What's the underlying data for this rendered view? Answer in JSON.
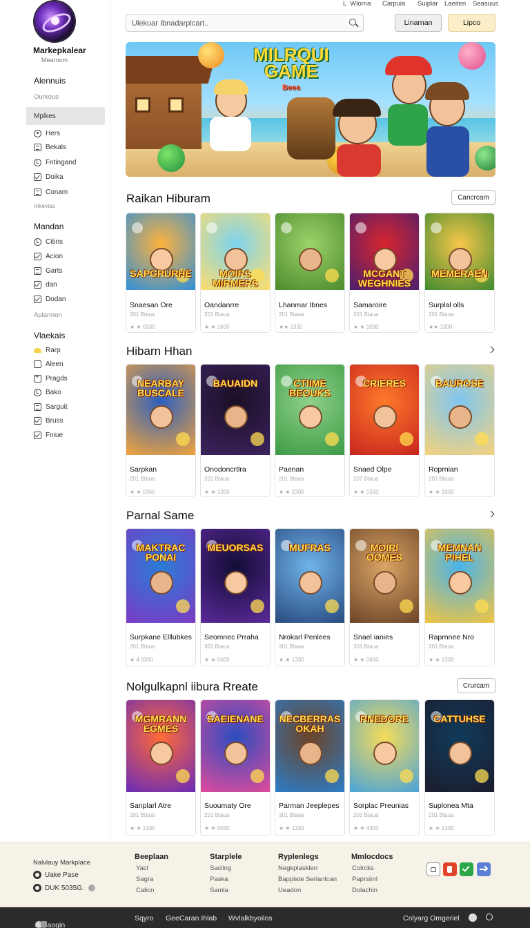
{
  "topnav": [
    "Wlorna",
    "Carpuia",
    "Suiplar",
    "Laeiten",
    "Seasuus"
  ],
  "search": {
    "placeholder": "Ulekuar Ibnadarplcart.."
  },
  "header_buttons": {
    "left": "Linarnan",
    "right": "Lipco"
  },
  "sidebar": {
    "brand": "Markepkalear",
    "brand_sub": "Mearnom",
    "sec1_title": "Alennuis",
    "sec1_muted": "Ourkous",
    "active": "Mplkes",
    "items1": [
      "Hers",
      "Bekals",
      "Fntingand",
      "Doika",
      "Conam"
    ],
    "muted2": "Inkeviss",
    "sec2_title": "Mandan",
    "items2": [
      "Citins",
      "Acion",
      "Garts",
      "dan",
      "Dodan"
    ],
    "muted3": "Aplarmon",
    "sec3_title": "Vlaekais",
    "items3": [
      "Rarp",
      "Aleen",
      "Pragds",
      "Bako",
      "Sarguit",
      "Bruss",
      "Fniue"
    ]
  },
  "hero": {
    "title_line1": "MILRQUI",
    "title_line2": "GAME",
    "title_sub": "Beea"
  },
  "sections": [
    {
      "title": "Raikan Hiburam",
      "action": "Cancrcam",
      "cards": [
        {
          "art": "SAPGRURHE",
          "name": "Snaesan Ore",
          "meta": "201 Btaua",
          "rating": "★ ★ 0330"
        },
        {
          "art": "MOIRS MIRMERS",
          "name": "Oandanrre",
          "meta": "201 Btaua",
          "rating": "★ ★ 1600"
        },
        {
          "art": "",
          "name": "Lhanmar Ibnes",
          "meta": "201 Btaua",
          "rating": "★★ 1330"
        },
        {
          "art": "MCGANT WEGHNIES",
          "name": "Samaroire",
          "meta": "201 Btaua",
          "rating": "★ ★ 1030"
        },
        {
          "art": "MEMERAEN",
          "name": "Surplal olls",
          "meta": "201 Btaua",
          "rating": "★★ 1300"
        }
      ]
    },
    {
      "title": "Hibarn Hhan",
      "action": "",
      "cards": [
        {
          "art": "NEARBAY BUSCALE",
          "name": "Sarpkan",
          "meta": "201 Btaua",
          "rating": "★ ★ 0350"
        },
        {
          "art": "BAUAIDN",
          "name": "Onodoncrtlra",
          "meta": "201 Btaua",
          "rating": "★ ★ 1300"
        },
        {
          "art": "CTIIME BEOUKS",
          "name": "Paenan",
          "meta": "201 Btaua",
          "rating": "★ ★ 2300"
        },
        {
          "art": "CRIERES",
          "name": "Snaed Olpe",
          "meta": "207 Btaua",
          "rating": "★ ★ 1333"
        },
        {
          "art": "BAUROSE",
          "name": "Roprnian",
          "meta": "201 Btaua",
          "rating": "★ ★ 1030"
        }
      ]
    },
    {
      "title": "Parnal Same",
      "action": "",
      "cards": [
        {
          "art": "MAKTRAC PONAI",
          "name": "Surpkane Elllubkes",
          "meta": "201 Btaua",
          "rating": "★ 4 0350"
        },
        {
          "art": "MEUORSAS",
          "name": "Seomnec Prraha",
          "meta": "301 Btaua",
          "rating": "★ ★ 0600"
        },
        {
          "art": "MUFRAS",
          "name": "Nrokarl Penlees",
          "meta": "301 Btaua",
          "rating": "★ ★ 1330"
        },
        {
          "art": "MOIRI OOMES",
          "name": "Snael ianies",
          "meta": "301 Btaua",
          "rating": "★ ★ 0650"
        },
        {
          "art": "MEMNAN PIHEL",
          "name": "Raprnnee Nro",
          "meta": "201 Btaua",
          "rating": "★ ★ 1330"
        }
      ]
    },
    {
      "title": "Nolgulkapnl iibura Rreate",
      "action": "Crurcam",
      "cards": [
        {
          "art": "MGMRANN EGMES",
          "name": "Sanplarl Atre",
          "meta": "201 Btaua",
          "rating": "★ ★ 1330"
        },
        {
          "art": "SAEIENANE",
          "name": "Suoumaty Ore",
          "meta": "201 Btaua",
          "rating": "★ ★ 5030"
        },
        {
          "art": "NECBERRAS OKAH",
          "name": "Parman Jeeplepes",
          "meta": "301 Btaua",
          "rating": "★ ★ 1330"
        },
        {
          "art": "RNEDORE",
          "name": "Sorplac Preunias",
          "meta": "201 Btaua",
          "rating": "★ ★ 4350"
        },
        {
          "art": "CATTUHSE",
          "name": "Suplonea Mta",
          "meta": "201 Btaua",
          "rating": "★ ★ 1330"
        }
      ]
    }
  ],
  "footer": {
    "brand_line": "Nalvlauy Markplace",
    "line2": "Uake Pase",
    "line3": "DUK 5035G.",
    "cols": [
      {
        "head": "Beeplaan",
        "links": [
          "Yacl",
          "Sagra",
          "Calicn"
        ]
      },
      {
        "head": "Starplele",
        "links": [
          "Sacling",
          "Paska",
          "Samla"
        ]
      },
      {
        "head": "Ryplenlegs",
        "links": [
          "Negkplasklen",
          "Bapplate Serlanlcan",
          "Ueadon"
        ]
      },
      {
        "head": "Mmlocdocs",
        "links": [
          "Colrcks",
          "Paprsiml",
          "Dolachin"
        ]
      }
    ]
  },
  "bottombar": {
    "left": "Apllaogin",
    "mid1": "Sqyro",
    "mid2": "GeeCaran Ihlab",
    "mid3": "Wvlalkbyoilos",
    "right": "Cnlyarg Omgeriel"
  },
  "colors": {
    "active_bg": "#e5e5e5",
    "cream_btn": "#fbeec9",
    "footer_bg": "#f6f2e7",
    "bottombar_bg": "#2b2b2b"
  }
}
